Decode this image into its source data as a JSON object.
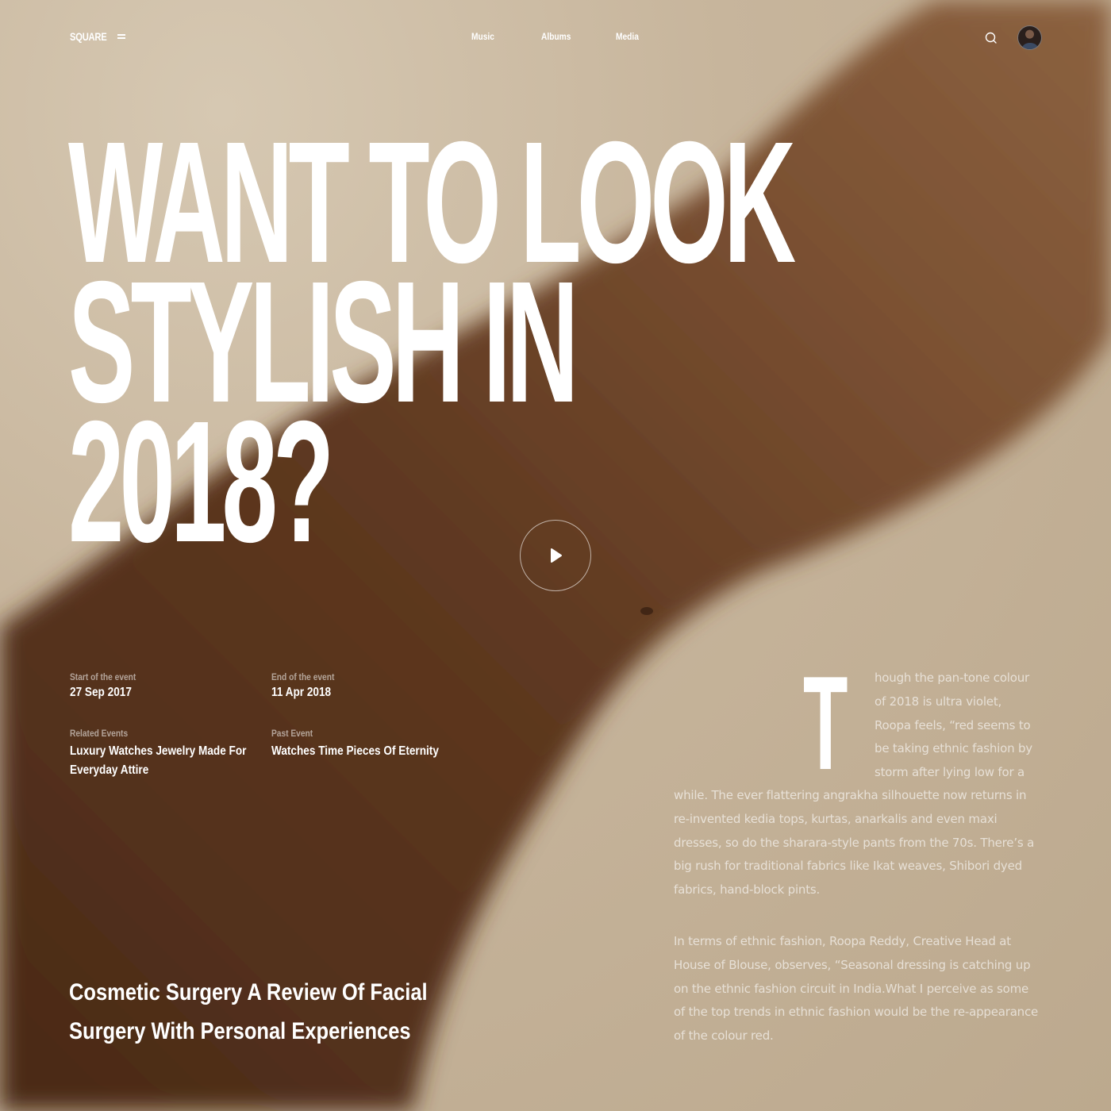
{
  "header": {
    "logo": "SQUARE",
    "nav": [
      "Music",
      "Albums",
      "Media"
    ]
  },
  "hero": {
    "headline_lines": [
      "WANT TO LOOK",
      "STYLISH IN",
      "2018?"
    ]
  },
  "event": {
    "start_label": "Start of the event",
    "start_value": "27 Sep 2017",
    "end_label": "End of the event",
    "end_value": "11 Apr 2018",
    "related_label": "Related Events",
    "related_value": "Luxury Watches Jewelry Made For Everyday Attire",
    "past_label": "Past Event",
    "past_value": "Watches Time Pieces Of Eternity"
  },
  "feature_title": "Cosmetic Surgery A Review Of Facial Surgery With Personal Experiences",
  "article": {
    "drop_cap": "T",
    "p1_first": "hough the pan-tone colour of 2018 is ultra violet, Roopa feels, “red seems to be taking ethnic fashion by storm after lying low for a",
    "p1_rest": "while. The ever flattering angrakha silhouette now returns in re-invented kedia tops, kurtas, anarkalis and even maxi dresses, so do the sharara-style pants from the 70s. There’s a big rush for traditional fabrics like Ikat weaves, Shibori dyed fabrics, hand-block pints.",
    "p2": "In terms of ethnic fashion, Roopa Reddy, Creative Head at House of Blouse, observes, “Seasonal dressing is catching up on the ethnic fashion circuit in India.What I perceive as some of the top trends in ethnic fashion would be the re-appearance of the colour red."
  },
  "icons": [
    "menu-icon",
    "search-icon",
    "avatar",
    "play-icon"
  ],
  "colors": {
    "background": "#c9b9a2",
    "skin_dark": "#5a3520",
    "text": "#ffffff"
  }
}
